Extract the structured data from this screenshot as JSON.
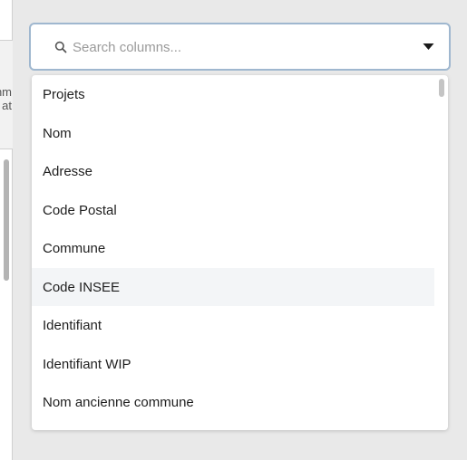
{
  "background_panel": {
    "header_partial_line1": "nm",
    "header_partial_line2": "at"
  },
  "search": {
    "placeholder": "Search columns...",
    "value": ""
  },
  "icons": {
    "search": "search-icon",
    "dropdown": "caret-down-icon"
  },
  "colors": {
    "focus_border": "#9fb7cf",
    "highlight_row": "#f3f5f7"
  },
  "options": [
    {
      "label": "Projets"
    },
    {
      "label": "Nom"
    },
    {
      "label": "Adresse"
    },
    {
      "label": "Code Postal"
    },
    {
      "label": "Commune"
    },
    {
      "label": "Code INSEE"
    },
    {
      "label": "Identifiant"
    },
    {
      "label": "Identifiant WIP"
    },
    {
      "label": "Nom ancienne commune"
    }
  ],
  "highlighted_option": "Code INSEE"
}
